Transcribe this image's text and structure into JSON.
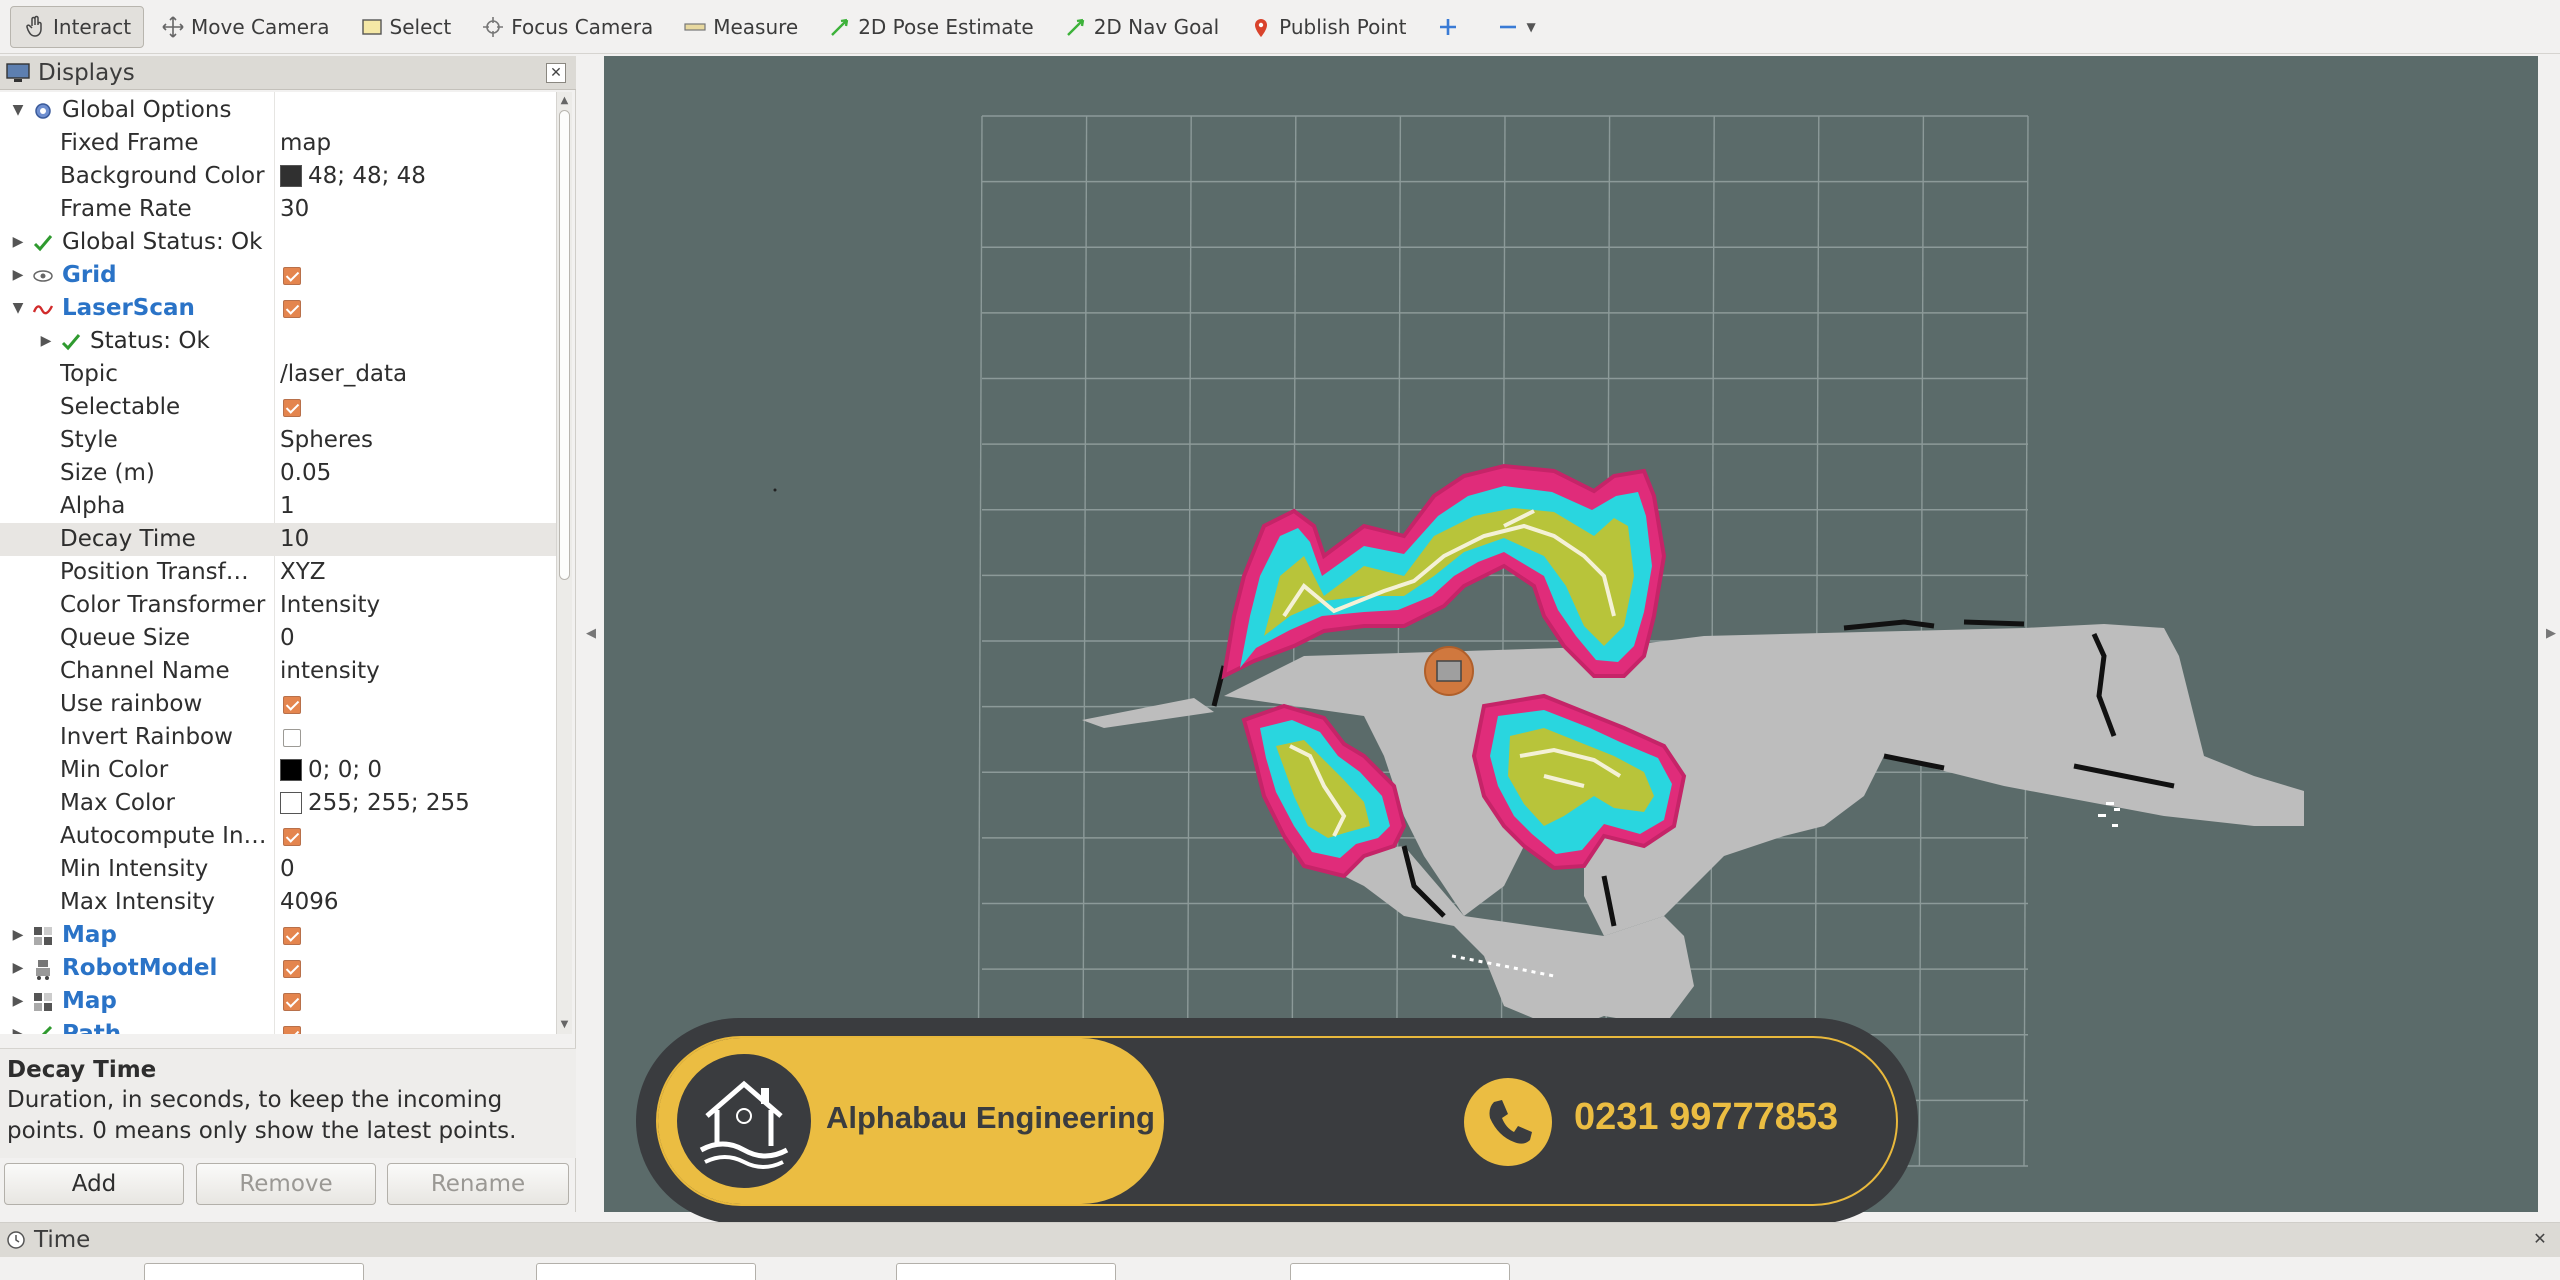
{
  "toolbar": {
    "tools": [
      {
        "label": "Interact",
        "icon": "hand-pointer-icon",
        "active": true
      },
      {
        "label": "Move Camera",
        "icon": "move-camera-icon"
      },
      {
        "label": "Select",
        "icon": "select-box-icon"
      },
      {
        "label": "Focus Camera",
        "icon": "focus-target-icon"
      },
      {
        "label": "Measure",
        "icon": "ruler-icon"
      },
      {
        "label": "2D Pose Estimate",
        "icon": "green-arrow-icon"
      },
      {
        "label": "2D Nav Goal",
        "icon": "green-arrow-icon"
      },
      {
        "label": "Publish Point",
        "icon": "map-pin-icon"
      }
    ]
  },
  "displays": {
    "title": "Displays",
    "rows": [
      {
        "name": "Global Options",
        "value": "",
        "style": "normal",
        "depth": 0,
        "expand": "open",
        "icon": "gear-icon"
      },
      {
        "name": "Fixed Frame",
        "value": "map",
        "depth": 1
      },
      {
        "name": "Background Color",
        "value": "48; 48; 48",
        "swatch": "#303030",
        "depth": 1
      },
      {
        "name": "Frame Rate",
        "value": "30",
        "depth": 1
      },
      {
        "name": "Global Status: Ok",
        "value": "",
        "style": "bold",
        "depth": 0,
        "expand": "closed",
        "icon": "check-icon"
      },
      {
        "name": "Grid",
        "value": "",
        "check": true,
        "style": "blue",
        "depth": 0,
        "expand": "closed",
        "icon": "grid-icon"
      },
      {
        "name": "LaserScan",
        "value": "",
        "check": true,
        "style": "blue",
        "depth": 0,
        "expand": "open",
        "icon": "laser-icon"
      },
      {
        "name": "Status: Ok",
        "value": "",
        "style": "bold",
        "depth": 1,
        "expand": "closed",
        "icon": "check-icon"
      },
      {
        "name": "Topic",
        "value": "/laser_data",
        "depth": 1
      },
      {
        "name": "Selectable",
        "value": "",
        "check": true,
        "depth": 1
      },
      {
        "name": "Style",
        "value": "Spheres",
        "depth": 1
      },
      {
        "name": "Size (m)",
        "value": "0.05",
        "depth": 1
      },
      {
        "name": "Alpha",
        "value": "1",
        "depth": 1
      },
      {
        "name": "Decay Time",
        "value": "10",
        "depth": 1,
        "selected": true
      },
      {
        "name": "Position Transf…",
        "value": "XYZ",
        "depth": 1
      },
      {
        "name": "Color Transformer",
        "value": "Intensity",
        "depth": 1
      },
      {
        "name": "Queue Size",
        "value": "0",
        "depth": 1
      },
      {
        "name": "Channel Name",
        "value": "intensity",
        "depth": 1
      },
      {
        "name": "Use rainbow",
        "value": "",
        "check": true,
        "depth": 1
      },
      {
        "name": "Invert Rainbow",
        "value": "",
        "check": false,
        "depth": 1
      },
      {
        "name": "Min Color",
        "value": "0; 0; 0",
        "swatch": "#000000",
        "depth": 1
      },
      {
        "name": "Max Color",
        "value": "255; 255; 255",
        "swatch": "#ffffff",
        "depth": 1
      },
      {
        "name": "Autocompute In…",
        "value": "",
        "check": true,
        "depth": 1
      },
      {
        "name": "Min Intensity",
        "value": "0",
        "depth": 1
      },
      {
        "name": "Max Intensity",
        "value": "4096",
        "depth": 1
      },
      {
        "name": "Map",
        "value": "",
        "check": true,
        "style": "blue",
        "depth": 0,
        "expand": "closed",
        "icon": "map-icon"
      },
      {
        "name": "RobotModel",
        "value": "",
        "check": true,
        "style": "blue",
        "depth": 0,
        "expand": "closed",
        "icon": "robot-icon"
      },
      {
        "name": "Map",
        "value": "",
        "check": true,
        "style": "blue",
        "depth": 0,
        "expand": "closed",
        "icon": "map-icon"
      },
      {
        "name": "Path",
        "value": "",
        "check": true,
        "style": "blue",
        "depth": 0,
        "expand": "closed",
        "icon": "path-icon"
      }
    ],
    "description": {
      "title": "Decay Time",
      "line1": "Duration, in seconds, to keep the incoming",
      "line2": "points. 0 means only show the latest points."
    },
    "buttons": {
      "add": "Add",
      "remove": "Remove",
      "rename": "Rename"
    }
  },
  "banner": {
    "company": "Alphabau Engineering",
    "phone": "0231 99777853"
  },
  "time": {
    "title": "Time"
  },
  "colors": {
    "background": "#5b6b6a",
    "accent": "#ebbd42",
    "checkbox": "#e4854e"
  }
}
